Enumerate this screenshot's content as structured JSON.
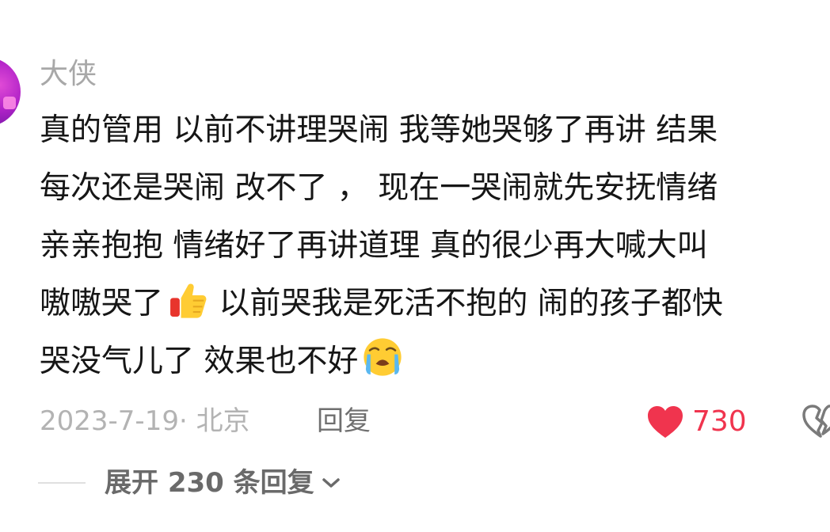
{
  "comment": {
    "author": "大侠",
    "lines": [
      "真的管用 以前不讲理哭闹 我等她哭够了再讲 结果",
      "每次还是哭闹 改不了 ， 现在一哭闹就先安抚情绪",
      "亲亲抱抱 情绪好了再讲道理 真的很少再大喊大叫",
      "嗷嗷哭了",
      " 以前哭我是死活不抱的 闹的孩子都快",
      "哭没气儿了 效果也不好"
    ],
    "emojis": [
      "thumbs-up-emoji",
      "loudly-crying-face-emoji"
    ],
    "date_location": "2023-7-19· 北京",
    "reply_label": "回复",
    "like_count": "730",
    "like_color": "#f0344e",
    "expand_label": "展开 230 条回复",
    "avatar_colors": [
      "#e14bd6",
      "#7a18a8"
    ]
  },
  "icons": {
    "like": "heart-icon",
    "dislike": "broken-heart-icon",
    "expand": "chevron-down-icon"
  }
}
